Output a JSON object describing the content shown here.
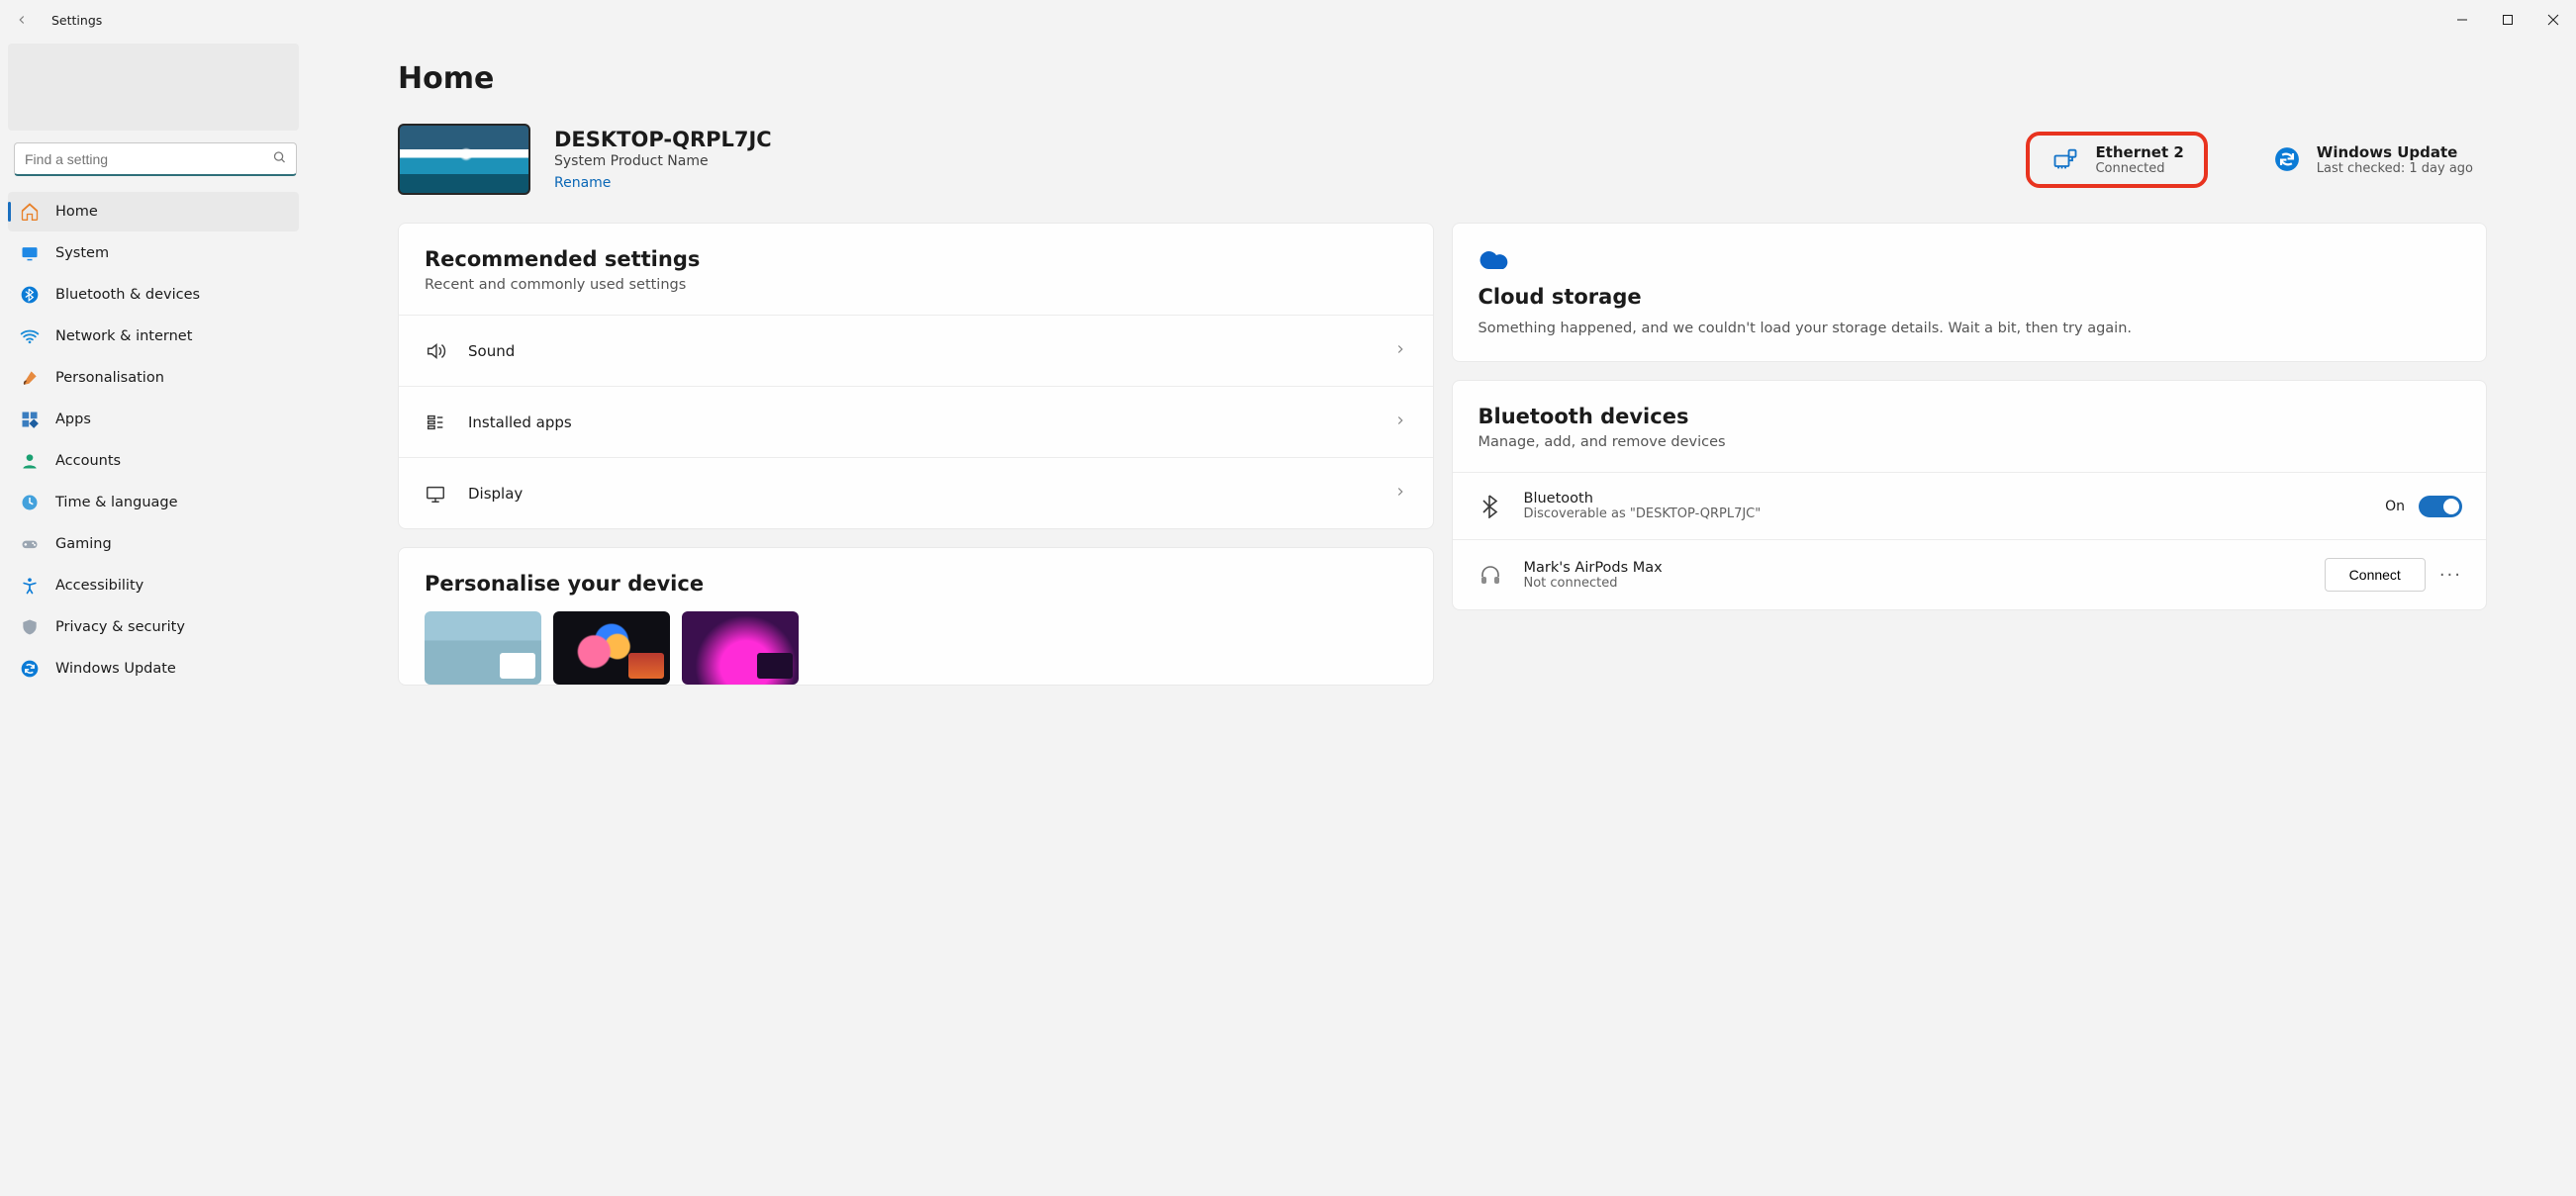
{
  "window": {
    "title": "Settings"
  },
  "search": {
    "placeholder": "Find a setting"
  },
  "sidebar": {
    "items": [
      {
        "label": "Home",
        "active": true
      },
      {
        "label": "System",
        "active": false
      },
      {
        "label": "Bluetooth & devices",
        "active": false
      },
      {
        "label": "Network & internet",
        "active": false
      },
      {
        "label": "Personalisation",
        "active": false
      },
      {
        "label": "Apps",
        "active": false
      },
      {
        "label": "Accounts",
        "active": false
      },
      {
        "label": "Time & language",
        "active": false
      },
      {
        "label": "Gaming",
        "active": false
      },
      {
        "label": "Accessibility",
        "active": false
      },
      {
        "label": "Privacy & security",
        "active": false
      },
      {
        "label": "Windows Update",
        "active": false
      }
    ]
  },
  "page": {
    "title": "Home",
    "device": {
      "name": "DESKTOP-QRPL7JC",
      "product": "System Product Name",
      "rename_label": "Rename"
    },
    "network": {
      "title": "Ethernet 2",
      "status": "Connected",
      "highlighted": true
    },
    "update": {
      "title": "Windows Update",
      "status": "Last checked: 1 day ago"
    }
  },
  "recommended": {
    "title": "Recommended settings",
    "subtitle": "Recent and commonly used settings",
    "rows": [
      {
        "label": "Sound"
      },
      {
        "label": "Installed apps"
      },
      {
        "label": "Display"
      }
    ]
  },
  "personalise": {
    "title": "Personalise your device"
  },
  "cloud": {
    "title": "Cloud storage",
    "body": "Something happened, and we couldn't load your storage details. Wait a bit, then try again."
  },
  "bluetooth": {
    "title": "Bluetooth devices",
    "subtitle": "Manage, add, and remove devices",
    "toggle": {
      "label": "Bluetooth",
      "sub": "Discoverable as \"DESKTOP-QRPL7JC\"",
      "state_label": "On"
    },
    "device": {
      "name": "Mark's AirPods Max",
      "status": "Not connected",
      "connect_label": "Connect"
    }
  }
}
